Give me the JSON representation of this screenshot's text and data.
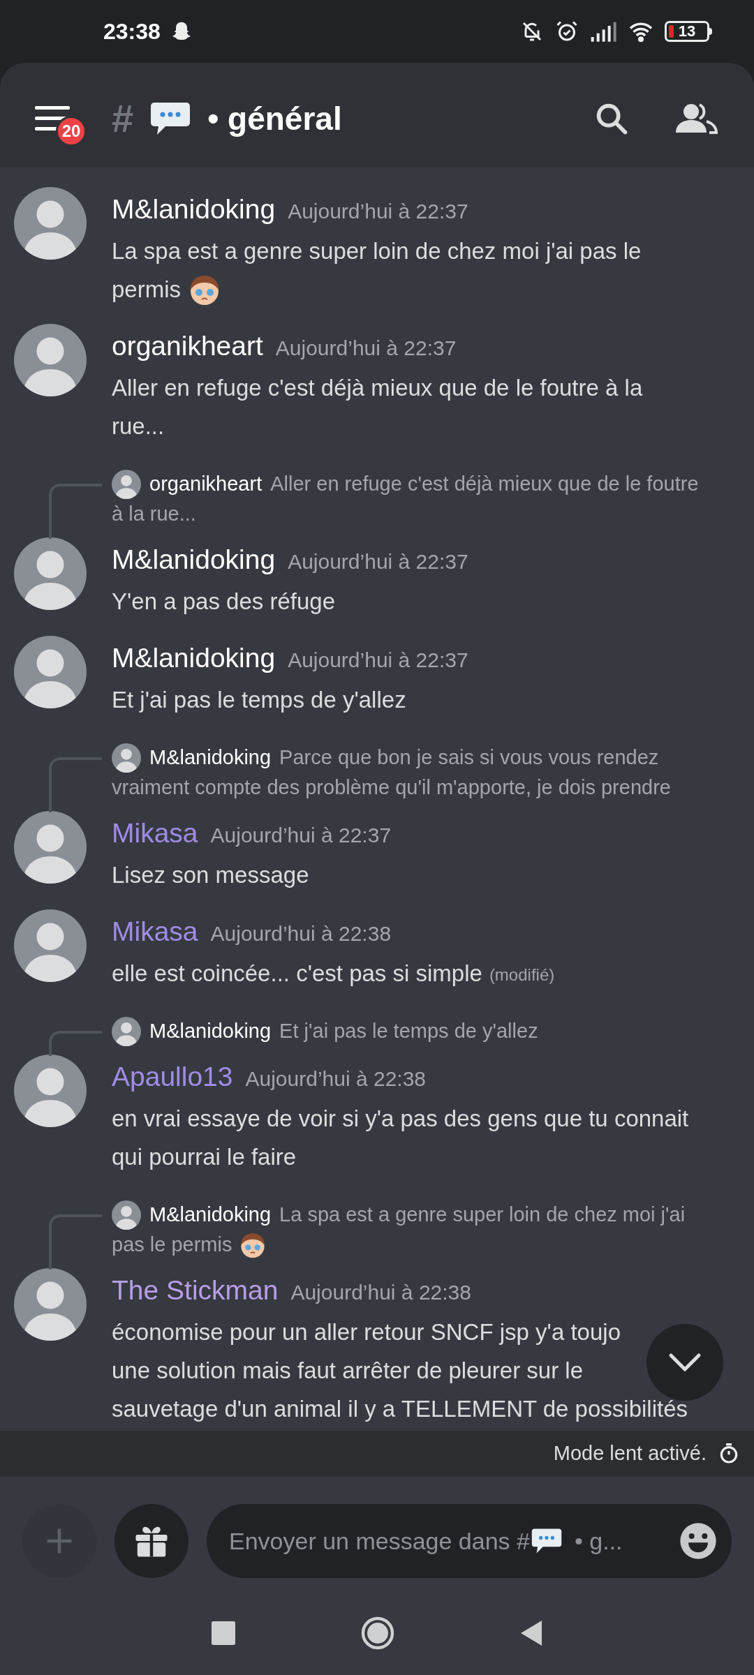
{
  "status_bar": {
    "time": "23:38",
    "battery": "13"
  },
  "header": {
    "hash": "#",
    "channel": "• général",
    "badge": "20"
  },
  "messages": [
    {
      "author": "M&lanidoking",
      "color": "#ffffff",
      "time": "Aujourd’hui à 22:37",
      "lines": [
        "La spa est a genre super loin de chez moi j'ai pas le",
        "permis"
      ],
      "emoji": true
    },
    {
      "author": "organikheart",
      "color": "#ffffff",
      "time": "Aujourd’hui à 22:37",
      "lines": [
        "Aller en refuge c'est déjà mieux que de le foutre à la",
        "rue..."
      ],
      "emoji": false
    },
    {
      "reply": {
        "author": "organikheart",
        "lines": [
          "Aller en refuge c'est déjà mieux que de le foutre",
          "à la rue..."
        ],
        "emoji": false
      },
      "author": "M&lanidoking",
      "color": "#ffffff",
      "time": "Aujourd’hui à 22:37",
      "lines": [
        "Y'en a pas des réfuge"
      ],
      "emoji": false
    },
    {
      "author": "M&lanidoking",
      "color": "#ffffff",
      "time": "Aujourd’hui à 22:37",
      "lines": [
        "Et j'ai pas le temps de y'allez"
      ],
      "emoji": false
    },
    {
      "reply": {
        "author": "M&lanidoking",
        "lines": [
          "Parce que bon je sais si vous vous rendez",
          "vraiment compte des problème qu'il m'apporte, je dois prendre"
        ],
        "emoji": false
      },
      "author": "Mikasa",
      "color": "#a08ce6",
      "time": "Aujourd’hui à 22:37",
      "lines": [
        "Lisez son message"
      ],
      "emoji": false
    },
    {
      "author": "Mikasa",
      "color": "#a08ce6",
      "time": "Aujourd’hui à 22:38",
      "lines": [
        "elle est coincée... c'est pas si simple"
      ],
      "edited": "(modifié)",
      "emoji": false
    },
    {
      "reply": {
        "author": "M&lanidoking",
        "lines": [
          "Et j'ai pas le temps de y'allez"
        ],
        "emoji": false
      },
      "author": "Apaullo13",
      "color": "#a08ce6",
      "time": "Aujourd’hui à 22:38",
      "lines": [
        "en vrai essaye de voir si y'a pas des gens que tu connait",
        "qui pourrai le faire"
      ],
      "emoji": false
    },
    {
      "reply": {
        "author": "M&lanidoking",
        "lines": [
          "La spa est a genre super loin de chez moi j'ai",
          "pas le permis"
        ],
        "emoji": true
      },
      "author": "The Stickman",
      "color": "#b99de8",
      "time": "Aujourd’hui à 22:38",
      "lines": [
        "économise pour un aller retour SNCF jsp y'a toujo",
        "une solution mais faut arrêter de pleurer sur le",
        "sauvetage d'un animal il y a TELLEMENT de possibilités"
      ],
      "emoji": false
    }
  ],
  "slow_mode": "Mode lent activé.",
  "composer": {
    "hint_start": "Envoyer un message dans #",
    "hint_end": "• g..."
  }
}
